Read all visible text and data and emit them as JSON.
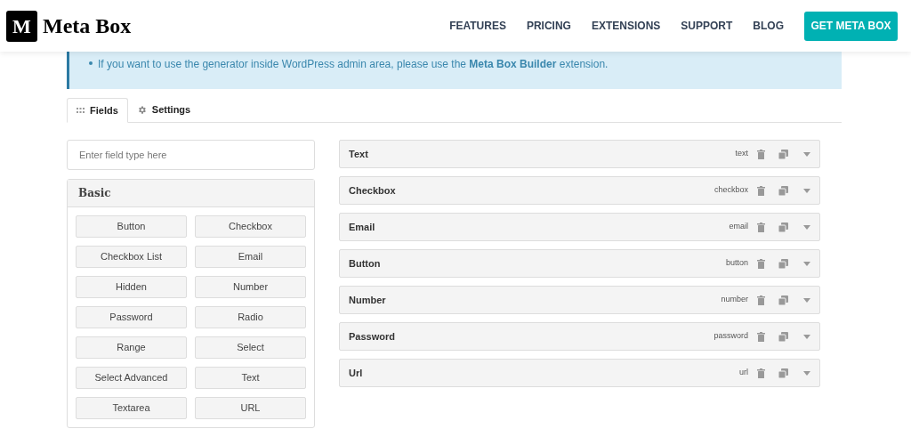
{
  "header": {
    "logo_letter": "M",
    "brand": "Meta Box",
    "nav": [
      "FEATURES",
      "PRICING",
      "EXTENSIONS",
      "SUPPORT",
      "BLOG"
    ],
    "cta": "GET META BOX"
  },
  "notice": {
    "text": "If you want to use the generator inside WordPress admin area, please use the **Meta Box Builder** extension."
  },
  "tabs": [
    {
      "label": "Fields",
      "kind": "grid",
      "selected": true
    },
    {
      "label": "Settings",
      "kind": "gear",
      "selected": false
    }
  ],
  "search": {
    "placeholder": "Enter field type here"
  },
  "group": {
    "title": "Basic",
    "types": [
      "Button",
      "Checkbox",
      "Checkbox List",
      "Email",
      "Hidden",
      "Number",
      "Password",
      "Radio",
      "Range",
      "Select",
      "Select Advanced",
      "Text",
      "Textarea",
      "URL"
    ]
  },
  "fields": [
    {
      "label": "Text",
      "type": "text"
    },
    {
      "label": "Checkbox",
      "type": "checkbox"
    },
    {
      "label": "Email",
      "type": "email"
    },
    {
      "label": "Button",
      "type": "button"
    },
    {
      "label": "Number",
      "type": "number"
    },
    {
      "label": "Password",
      "type": "password"
    },
    {
      "label": "Url",
      "type": "url"
    }
  ]
}
